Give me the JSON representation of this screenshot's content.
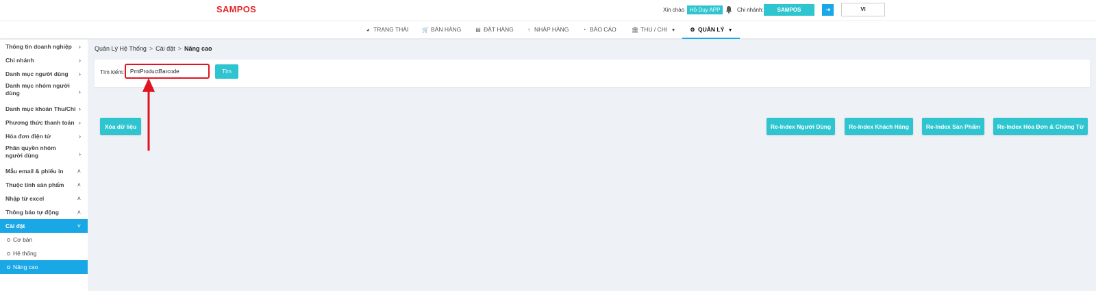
{
  "header": {
    "logo": "SAMPOS",
    "greeting": "Xin chào",
    "user_name": "Hồ Duy APP",
    "branch_label": "Chi nhánh:",
    "branch_name": "SAMPOS",
    "language": "VI"
  },
  "nav": {
    "items": [
      {
        "label": "TRẠNG THÁI",
        "icon": "dashboard-icon"
      },
      {
        "label": "BÁN HÀNG",
        "icon": "cart-icon"
      },
      {
        "label": "ĐẶT HÀNG",
        "icon": "calendar-icon"
      },
      {
        "label": "NHẬP HÀNG",
        "icon": "arrow-up-icon"
      },
      {
        "label": "BÁO CÁO",
        "icon": "pie-chart-icon"
      },
      {
        "label": "THU / CHI",
        "icon": "bank-icon"
      },
      {
        "label": "QUẢN LÝ",
        "icon": "gear-icon"
      }
    ]
  },
  "sidebar": {
    "items": [
      {
        "label": "Thông tin doanh nghiệp",
        "arrow": "›"
      },
      {
        "label": "Chi nhánh",
        "arrow": "›"
      },
      {
        "label": "Danh mục người dùng",
        "arrow": "›"
      },
      {
        "label": "Danh mục nhóm người dùng",
        "arrow": "›"
      },
      {
        "label": "Danh mục khoản Thu/Chi",
        "arrow": "›"
      },
      {
        "label": "Phương thức thanh toán",
        "arrow": "›"
      },
      {
        "label": "Hóa đơn điện tử",
        "arrow": "›"
      },
      {
        "label": "Phân quyền nhóm người dùng",
        "arrow": "›"
      },
      {
        "label": "Mẫu email & phiếu in",
        "arrow": "˄"
      },
      {
        "label": "Thuộc tính sản phẩm",
        "arrow": "˄"
      },
      {
        "label": "Nhập từ excel",
        "arrow": "˄"
      },
      {
        "label": "Thông báo tự động",
        "arrow": "˄"
      },
      {
        "label": "Cài đặt",
        "arrow": "˅"
      }
    ],
    "subitems": [
      {
        "label": "Cơ bản"
      },
      {
        "label": "Hệ thống"
      },
      {
        "label": "Nâng cao"
      }
    ]
  },
  "breadcrumb": {
    "root": "Quản Lý Hệ Thống",
    "parent": "Cài đặt",
    "current": "Nâng cao",
    "separator": ">"
  },
  "search": {
    "label": "Tìm kiếm:",
    "value": "PmtProductBarcode",
    "button": "Tìm"
  },
  "actions": {
    "clear": "Xóa dữ liệu",
    "reindex_users": "Re-Index Người Dùng",
    "reindex_customers": "Re-Index Khách Hàng",
    "reindex_products": "Re-Index Sản Phẩm",
    "reindex_invoices": "Re-Index Hóa Đơn & Chứng Từ"
  },
  "colors": {
    "brand_red": "#e4262b",
    "accent_teal": "#2ec5d0",
    "active_blue": "#1aa7e6",
    "highlight_red": "#e0141e"
  }
}
